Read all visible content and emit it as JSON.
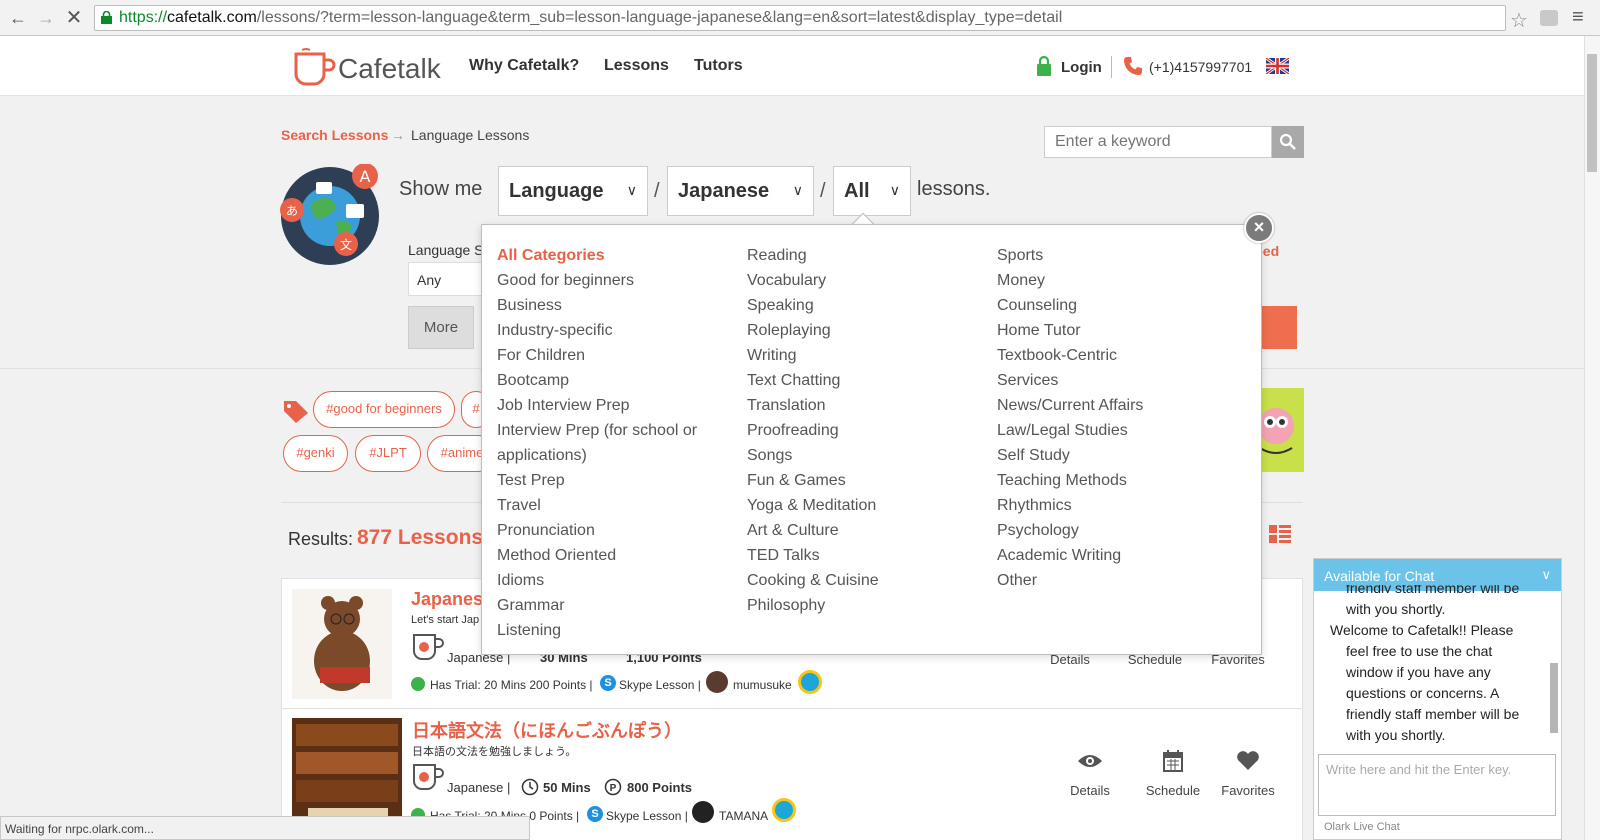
{
  "browser": {
    "url_scheme": "https://",
    "url_domain": "cafetalk.com",
    "url_path": "/lessons/?term=lesson-language&term_sub=lesson-language-japanese&lang=en&sort=latest&display_type=detail",
    "status": "Waiting for nrpc.olark.com..."
  },
  "header": {
    "logo": "Cafetalk",
    "nav": [
      "Why Cafetalk?",
      "Lessons",
      "Tutors"
    ],
    "login": "Login",
    "phone": "(+1)4157997701"
  },
  "breadcrumb": {
    "link": "Search Lessons",
    "arrow": "→",
    "current": "Language Lessons"
  },
  "search": {
    "placeholder": "Enter a keyword"
  },
  "filter": {
    "show_me": "Show me",
    "category": "Language",
    "subcategory": "Japanese",
    "type": "All",
    "suffix": "lessons.",
    "language_label": "Language S",
    "language_value": "Any",
    "more": "More",
    "speed_fragment": "eed"
  },
  "dropdown": {
    "columns": [
      [
        "All Categories",
        "Good for beginners",
        "Business",
        "Industry-specific",
        "For Children",
        "Bootcamp",
        "Job Interview Prep",
        "Interview Prep (for school or",
        "applications)",
        "Test Prep",
        "Travel",
        "Pronunciation",
        "Method Oriented",
        "Idioms",
        "Grammar",
        "Listening"
      ],
      [
        "Reading",
        "Vocabulary",
        "Speaking",
        "Roleplaying",
        "Writing",
        "Text Chatting",
        "Translation",
        "Proofreading",
        "Songs",
        "Fun & Games",
        "Yoga & Meditation",
        "Art & Culture",
        "TED Talks",
        "Cooking & Cuisine",
        "Philosophy"
      ],
      [
        "Sports",
        "Money",
        "Counseling",
        "Home Tutor",
        "Textbook-Centric",
        "Services",
        "News/Current Affairs",
        "Law/Legal Studies",
        "Self Study",
        "Teaching Methods",
        "Rhythmics",
        "Psychology",
        "Academic Writing",
        "Other"
      ]
    ]
  },
  "tags": [
    "#good for beginners",
    "#",
    "#genki",
    "#JLPT",
    "#anime"
  ],
  "results": {
    "label": "Results:",
    "count": "877 Lessons"
  },
  "lessons": [
    {
      "title": "Japanes",
      "subtitle": "Let's start Jap",
      "language": "Japanese |",
      "duration": "30 Mins",
      "points": "1,100  Points",
      "trial": "Has Trial: 20 Mins 200 Points |",
      "skype": "Skype Lesson |",
      "tutor": "mumusuke",
      "actions": [
        "Details",
        "Schedule",
        "Favorites"
      ]
    },
    {
      "title": "日本語文法（にほんごぶんぽう）",
      "subtitle": "日本語の文法を勉強しましょう。",
      "language": "Japanese |",
      "duration": "50 Mins",
      "points": "800  Points",
      "trial": "Has Trial: 20 Mins 0 Points |",
      "skype": "Skype Lesson |",
      "tutor": "TAMANA",
      "actions": [
        "Details",
        "Schedule",
        "Favorites"
      ]
    }
  ],
  "chat": {
    "header": "Available for Chat",
    "top_fragment": "friendly staff member will be",
    "text_lines": [
      "with you shortly.",
      "Welcome to Cafetalk!! Please",
      "feel free to use the chat",
      "window if you have any",
      "questions or concerns. A",
      "friendly staff member will be",
      "with you shortly."
    ],
    "input_placeholder": "Write here and hit the Enter key.",
    "footer": "Olark Live Chat"
  },
  "colors": {
    "brand": "#e8624a",
    "chat": "#6cc3ea",
    "link": "#e8624a"
  }
}
